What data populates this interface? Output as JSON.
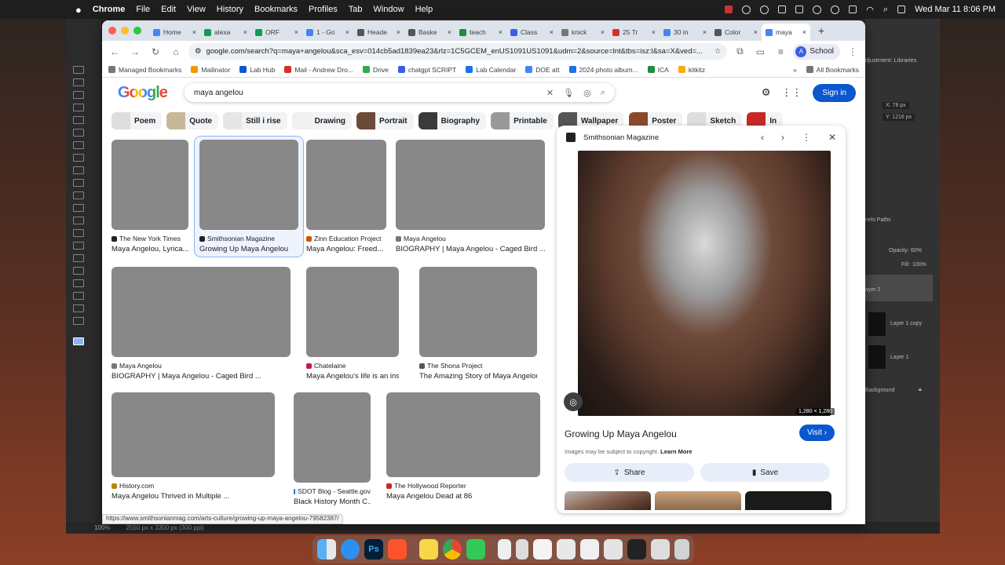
{
  "menubar": {
    "app_name": "Chrome",
    "menus": [
      "File",
      "Edit",
      "View",
      "History",
      "Bookmarks",
      "Profiles",
      "Tab",
      "Window",
      "Help"
    ],
    "datetime": "Wed Mar 11  8:06 PM"
  },
  "tabs": [
    {
      "label": "Home",
      "color": "#4285f4"
    },
    {
      "label": "alexa",
      "color": "#0f9d58"
    },
    {
      "label": "ORF",
      "color": "#0f9d58"
    },
    {
      "label": "1 - Go",
      "color": "#4285f4"
    },
    {
      "label": "Heade",
      "color": "#555555"
    },
    {
      "label": "Baske",
      "color": "#555555"
    },
    {
      "label": "teach",
      "color": "#1e8e3e"
    },
    {
      "label": "Class",
      "color": "#3b5ee6"
    },
    {
      "label": "knick",
      "color": "#777777"
    },
    {
      "label": "25 Tr",
      "color": "#d93025"
    },
    {
      "label": "30 in",
      "color": "#4285f4"
    },
    {
      "label": "Color",
      "color": "#555555"
    },
    {
      "label": "maya",
      "color": "#4285f4",
      "active": true
    }
  ],
  "address": {
    "url": "google.com/search?q=maya+angelou&sca_esv=014cb5ad1839ea23&rlz=1C5GCEM_enUS1091US1091&udm=2&source=lnt&tbs=isz:l&sa=X&ved=...",
    "profile_label": "School",
    "profile_initial": "A"
  },
  "bookmarks": [
    "Managed Bookmarks",
    "Mailinator",
    "Lab Hub",
    "Mail - Andrew Dro...",
    "Drive",
    "chatgpt SCRIPT",
    "Lab Calendar",
    "DOE att",
    "2024 photo album...",
    "ICA",
    "kitkitz"
  ],
  "all_bookmarks": "All Bookmarks",
  "google": {
    "logo": "Google",
    "query": "maya angelou",
    "signin": "Sign in"
  },
  "chips": [
    "Poem",
    "Quote",
    "Still i rise",
    "Drawing",
    "Portrait",
    "Biography",
    "Printable",
    "Wallpaper",
    "Poster",
    "Sketch",
    "In"
  ],
  "results": [
    {
      "source": "The New York Times",
      "title": "Maya Angelou, Lyrica...",
      "c": "#222"
    },
    {
      "source": "Smithsonian Magazine",
      "title": "Growing Up Maya Angelou",
      "c": "#222"
    },
    {
      "source": "Zinn Education Project",
      "title": "Maya Angelou: Freed...",
      "c": "#d35400"
    },
    {
      "source": "Maya Angelou",
      "title": "BIOGRAPHY | Maya Angelou - Caged Bird ...",
      "c": "#777"
    },
    {
      "source": "Maya Angelou",
      "title": "BIOGRAPHY | Maya Angelou - Caged Bird ...",
      "c": "#777"
    },
    {
      "source": "Chatelaine",
      "title": "Maya Angelou's life is an inspi...",
      "c": "#c2185b"
    },
    {
      "source": "The Shona Project",
      "title": "The Amazing Story of Maya Angelou...",
      "c": "#555"
    },
    {
      "source": "History.com",
      "title": "Maya Angelou Thrived in Multiple ...",
      "c": "#b8860b"
    },
    {
      "source": "SDOT Blog - Seattle.gov",
      "title": "Black History Month C...",
      "c": "#1a73e8"
    },
    {
      "source": "The Hollywood Reporter",
      "title": "Maya Angelou Dead at 86",
      "c": "#c62828"
    }
  ],
  "panel": {
    "source": "Smithsonian Magazine",
    "dimensions": "1,280 × 1,280",
    "title": "Growing Up Maya Angelou",
    "visit": "Visit",
    "copyright": "Images may be subject to copyright.",
    "learn_more": "Learn More",
    "share": "Share",
    "save": "Save"
  },
  "hover_url": "https://www.smithsonianmag.com/arts-culture/growing-up-maya-angelou-79582387/",
  "photoshop": {
    "zoom": "100%",
    "doc_info": "2550 px x 3300 px (300 ppi)",
    "tabs": "djustment: Libraries",
    "x": "X: 78 px",
    "y": "Y: 1216 px",
    "panel2": "nels  Paths",
    "opacity_label": "Opacity:",
    "opacity": "60%",
    "fill_label": "Fill:",
    "fill": "100%",
    "layers": [
      "ayer 2",
      "Layer 1 copy",
      "Layer 1",
      "Background"
    ]
  }
}
